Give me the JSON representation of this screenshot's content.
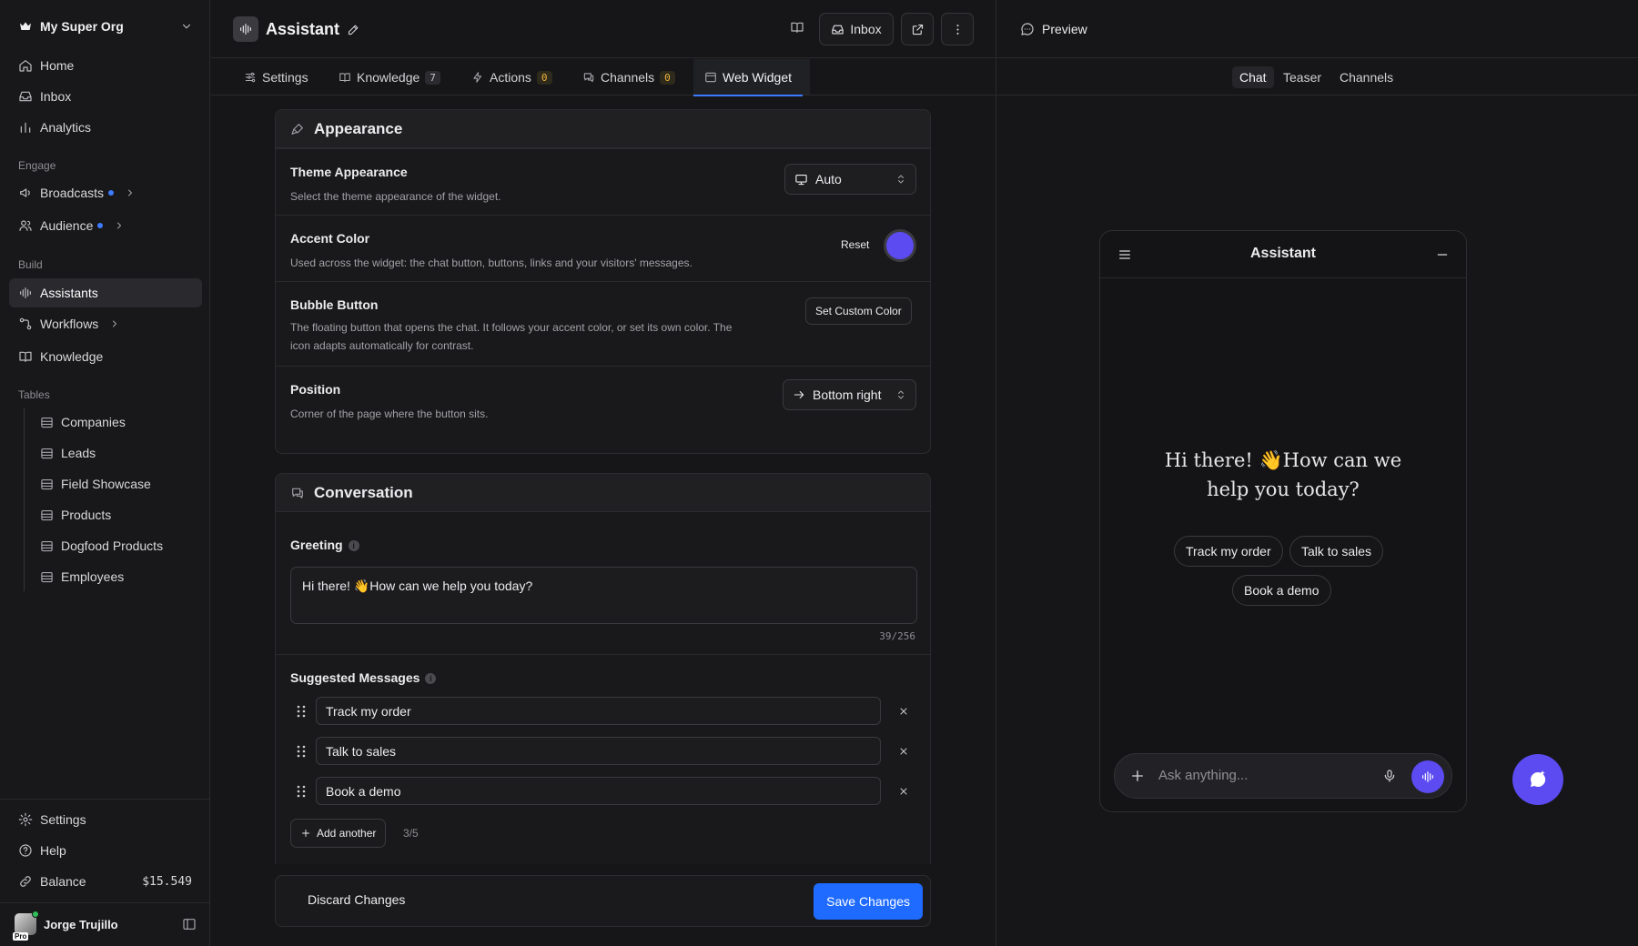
{
  "sidebar": {
    "org_name": "My Super Org",
    "top_items": [
      {
        "label": "Home",
        "icon": "home-icon"
      },
      {
        "label": "Inbox",
        "icon": "inbox-icon"
      },
      {
        "label": "Analytics",
        "icon": "analytics-icon"
      }
    ],
    "engage_label": "Engage",
    "engage_items": [
      {
        "label": "Broadcasts",
        "icon": "broadcast-icon"
      },
      {
        "label": "Audience",
        "icon": "audience-icon"
      }
    ],
    "build_label": "Build",
    "build_items": [
      {
        "label": "Assistants",
        "icon": "waveform-icon"
      },
      {
        "label": "Workflows",
        "icon": "workflow-icon"
      },
      {
        "label": "Knowledge",
        "icon": "book-icon"
      }
    ],
    "tables_label": "Tables",
    "tables": [
      "Companies",
      "Leads",
      "Field Showcase",
      "Products",
      "Dogfood Products",
      "Employees"
    ],
    "bottom_items": [
      {
        "label": "Settings",
        "icon": "gear-icon"
      },
      {
        "label": "Help",
        "icon": "help-icon"
      },
      {
        "label": "Balance",
        "icon": "link-icon"
      }
    ],
    "balance_value": "$15.549",
    "user_name": "Jorge Trujillo",
    "pro_label": "Pro"
  },
  "header": {
    "title": "Assistant",
    "inbox_label": "Inbox"
  },
  "tabs": [
    {
      "label": "Settings",
      "icon": "sliders-icon"
    },
    {
      "label": "Knowledge",
      "icon": "book-icon",
      "count": "7"
    },
    {
      "label": "Actions",
      "icon": "bolt-icon",
      "count": "0"
    },
    {
      "label": "Channels",
      "icon": "chat-bubbles-icon",
      "count": "0"
    },
    {
      "label": "Web Widget",
      "icon": "browser-icon"
    }
  ],
  "appearance": {
    "title": "Appearance",
    "theme_title": "Theme Appearance",
    "theme_desc": "Select the theme appearance of the widget.",
    "theme_value": "Auto",
    "accent_title": "Accent Color",
    "accent_desc": "Used across the widget: the chat button, buttons, links and your visitors' messages.",
    "accent_reset": "Reset",
    "accent_color": "#5b4bf0",
    "bubble_title": "Bubble Button",
    "bubble_desc_1": "The floating button that opens the chat. It follows your accent color, or set its own color. The",
    "bubble_desc_2": "icon adapts automatically for contrast.",
    "bubble_button": "Set Custom Color",
    "position_title": "Position",
    "position_desc": "Corner of the page where the button sits.",
    "position_value": "Bottom right"
  },
  "conversation": {
    "title": "Conversation",
    "greeting_label": "Greeting",
    "greeting_value": "Hi there! 👋How can we help you today?",
    "greeting_count": "39/256",
    "suggested_label": "Suggested Messages",
    "suggestions": [
      "Track my order",
      "Talk to sales",
      "Book a demo"
    ],
    "add_another": "Add another",
    "limit": "3/5"
  },
  "footer": {
    "discard": "Discard Changes",
    "save": "Save Changes"
  },
  "preview": {
    "title": "Preview",
    "tabs": [
      "Chat",
      "Teaser",
      "Channels"
    ],
    "active_tab": "Chat",
    "widget_title": "Assistant",
    "greeting": "Hi there! 👋How can we help you today?",
    "chips": [
      "Track my order",
      "Talk to sales",
      "Book a demo"
    ],
    "composer_placeholder": "Ask anything..."
  }
}
